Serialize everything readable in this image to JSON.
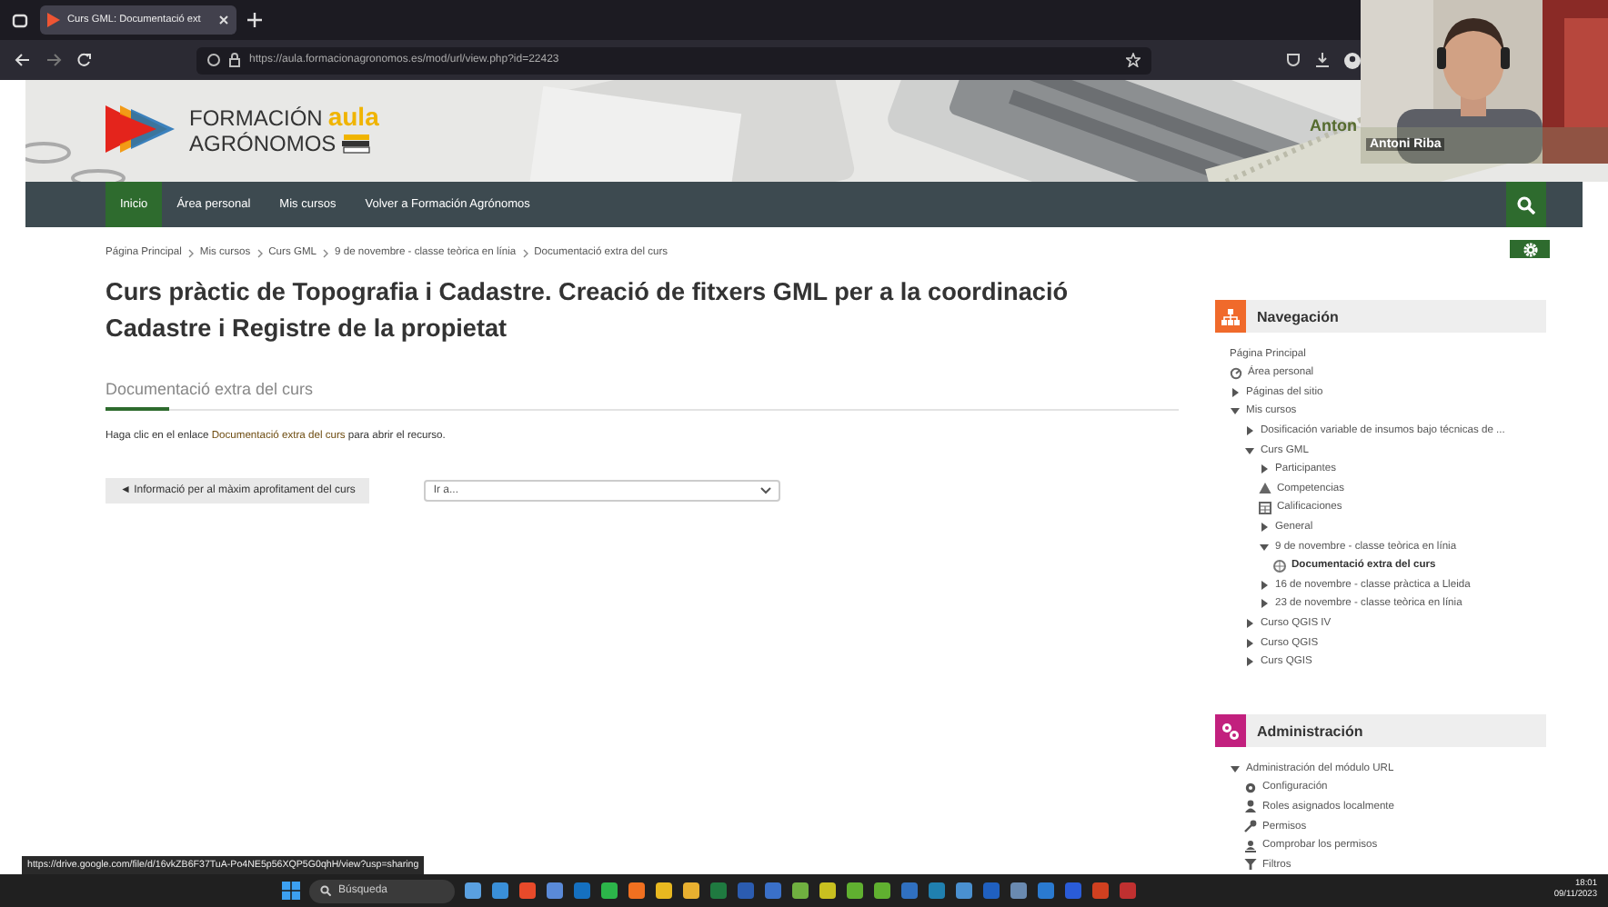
{
  "browser": {
    "tab_title": "Curs GML: Documentació ext",
    "url": "https://aula.formacionagronomos.es/mod/url/view.php?id=22423"
  },
  "header": {
    "logo_line1": "FORMACIÓN",
    "logo_accent": "aula",
    "logo_line2": "AGRÓNOMOS",
    "user_name": "Anton"
  },
  "video": {
    "name": "Antoni Riba"
  },
  "navbar": {
    "items": [
      {
        "label": "Inicio",
        "selected": true
      },
      {
        "label": "Área personal",
        "selected": false
      },
      {
        "label": "Mis cursos",
        "selected": false
      },
      {
        "label": "Volver a Formación Agrónomos",
        "selected": false
      }
    ]
  },
  "breadcrumb": [
    "Página Principal",
    "Mis cursos",
    "Curs GML",
    "9 de novembre - classe teòrica en línia",
    "Documentació extra del curs"
  ],
  "title": "Curs pràctic de Topografia i Cadastre. Creació de fitxers GML per a la coordinació Cadastre i Registre de la propietat",
  "section_title": "Documentació extra del curs",
  "instruction": {
    "before": "Haga clic en el enlace ",
    "link": "Documentació extra del curs",
    "after": " para abrir el recurso."
  },
  "prev_button": "◄ Informació per al màxim aprofitament del curs",
  "jump_select": {
    "value": "Ir a..."
  },
  "navigation": {
    "title": "Navegación",
    "items": [
      {
        "label": "Página Principal",
        "kind": "link",
        "selected": false
      },
      {
        "label": "Área personal",
        "kind": "dashboard",
        "selected": false
      },
      {
        "label": "Páginas del sitio",
        "kind": "branch",
        "expanded": false,
        "selected": false
      },
      {
        "label": "Mis cursos",
        "kind": "branch",
        "expanded": true,
        "selected": false,
        "children": [
          {
            "label": "Dosificación variable de insumos bajo técnicas de ...",
            "kind": "branch",
            "expanded": false,
            "selected": false
          },
          {
            "label": "Curs GML",
            "kind": "branch",
            "expanded": true,
            "selected": false,
            "children": [
              {
                "label": "Participantes",
                "kind": "branch",
                "expanded": false,
                "selected": false
              },
              {
                "label": "Competencias",
                "kind": "competencies",
                "selected": false
              },
              {
                "label": "Calificaciones",
                "kind": "grades",
                "selected": false
              },
              {
                "label": "General",
                "kind": "branch",
                "expanded": false,
                "selected": false
              },
              {
                "label": "9 de novembre - classe teòrica en línia",
                "kind": "branch",
                "expanded": true,
                "selected": false,
                "children": [
                  {
                    "label": "Documentació extra del curs",
                    "kind": "resource",
                    "selected": true
                  }
                ]
              },
              {
                "label": "16 de novembre - classe pràctica a Lleida",
                "kind": "branch",
                "expanded": false,
                "selected": false
              },
              {
                "label": "23 de novembre - classe teòrica en línia",
                "kind": "branch",
                "expanded": false,
                "selected": false
              }
            ]
          },
          {
            "label": "Curso QGIS IV",
            "kind": "branch",
            "expanded": false,
            "selected": false
          },
          {
            "label": "Curso QGIS",
            "kind": "branch",
            "expanded": false,
            "selected": false
          },
          {
            "label": "Curs QGIS",
            "kind": "branch",
            "expanded": false,
            "selected": false
          }
        ]
      }
    ]
  },
  "administration": {
    "title": "Administración",
    "items": [
      {
        "label": "Administración del módulo URL",
        "kind": "branch",
        "expanded": true,
        "children": [
          {
            "label": "Configuración",
            "kind": "settings"
          },
          {
            "label": "Roles asignados localmente",
            "kind": "roles"
          },
          {
            "label": "Permisos",
            "kind": "permissions"
          },
          {
            "label": "Comprobar los permisos",
            "kind": "check"
          },
          {
            "label": "Filtros",
            "kind": "filter"
          }
        ]
      }
    ]
  },
  "status_url": "https://drive.google.com/file/d/16vkZB6F37TuA-Po4NE5p56XQP5G0qhH/view?usp=sharing",
  "taskbar": {
    "search_placeholder": "Búsqueda",
    "time": "18:01",
    "date": "09/11/2023"
  }
}
